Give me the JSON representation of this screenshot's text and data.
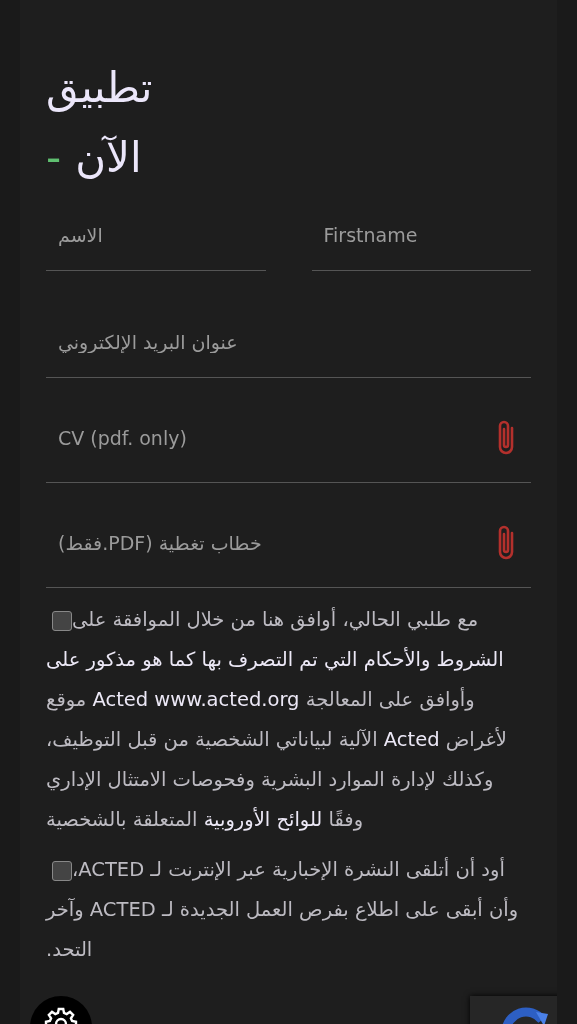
{
  "heading": {
    "line_1": "تطبيق",
    "line_2": "الآن",
    "dash": "-"
  },
  "fields": [
    {
      "kind": "text",
      "placeholder": "Firstname"
    },
    {
      "kind": "text",
      "placeholder": "الاسم"
    },
    {
      "kind": "text",
      "placeholder": "عنوان البريد الإلكتروني"
    },
    {
      "kind": "file",
      "placeholder": "CV (pdf. only)"
    },
    {
      "kind": "file",
      "placeholder": "(فقط.PDF) خطاب تغطية"
    }
  ],
  "consents": [
    {
      "checked": false,
      "text": "مع طلبي الحالي، أوافق هنا من خلال الموافقة على **الشروط والأحكام التي تم التصرف بها كما هو مذكور على** وأوافق على المعالجة **Acted www.acted.org** موقع لأغراض **Acted** الآلية لبياناتي الشخصية من قبل التوظيف، وكذلك لإدارة الموارد البشرية وفحوصات الامتثال الإداري وفقًا **للوائح الأوروبية** المتعلقة بالشخصية"
    },
    {
      "checked": false,
      "text": "أود أن أتلقى النشرة الإخبارية عبر الإنترنت لـ ACTED، وأن أبقى على اطلاع بفرص العمل الجديدة لـ ACTED وآخر التحد."
    }
  ]
}
